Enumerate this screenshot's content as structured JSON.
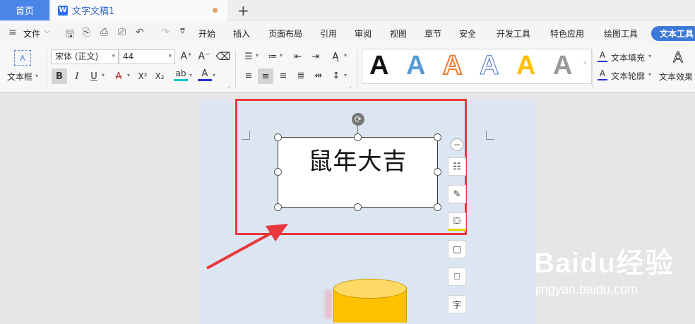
{
  "titlebar": {
    "home_tab": "首页",
    "doc_tab": "文字文稿1",
    "doc_icon": "W",
    "new_tab": "+"
  },
  "menubar": {
    "file": "文件",
    "tabs": [
      "开始",
      "插入",
      "页面布局",
      "引用",
      "审阅",
      "视图",
      "章节",
      "安全",
      "开发工具",
      "特色应用",
      "绘图工具"
    ],
    "active_tab": "文本工具"
  },
  "ribbon": {
    "textbox_label": "文本框",
    "font_name": "宋体 (正文)",
    "font_size": "44",
    "bold": "B",
    "italic": "I",
    "underline": "U",
    "strikeA": "A",
    "superscript": "X²",
    "subscript": "X₂",
    "highlight": "ab",
    "fontcolor": "A",
    "grow": "A⁺",
    "shrink": "A⁻",
    "style_letters": [
      "A",
      "A",
      "A",
      "A",
      "A",
      "A"
    ],
    "text_fill": "文本填充",
    "text_outline": "文本轮廓",
    "text_effect": "文本效果"
  },
  "document": {
    "textbox_text": "鼠年大吉"
  },
  "watermark": {
    "brand": "Baidu经验",
    "url": "jingyan.baidu.com"
  },
  "colors": {
    "accent": "#3c78d8",
    "highlight_box": "#e8383d",
    "page_bg": "#dbe6f2",
    "cylinder": "#ffc000"
  }
}
